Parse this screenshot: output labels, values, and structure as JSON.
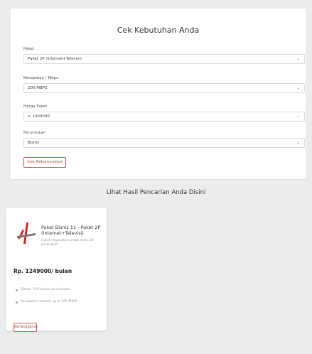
{
  "form": {
    "title": "Cek Kebutuhan Anda",
    "fields": [
      {
        "label": "Paket",
        "value": "Paket 2P (Internet+Televisi)"
      },
      {
        "label": "Kecepatan / Mbps",
        "value": "200 MBPS"
      },
      {
        "label": "Harga Paket",
        "value": "> 1000000"
      },
      {
        "label": "Peruntukan",
        "value": "Bisnis"
      }
    ],
    "submit_label": "Cek Rekomendasi"
  },
  "results": {
    "title": "Lihat Hasil Pencarian Anda Disini",
    "packages": [
      {
        "name": "Paket Bisnis 11 - Paket 2P (Internet+Televisi)",
        "description": "Cocok digunakan untuk maks 20 perangkat",
        "price": "Rp. 1249000/ bulan",
        "benefits": [
          "Diskon 70% biaya pasang baru",
          "Kecepatan internet up to 200 MBPS"
        ],
        "subscribe_label": "Berlangganan",
        "logo_colors": {
          "primary": "#d9261c",
          "secondary": "#7a7a7a"
        }
      }
    ]
  },
  "icons": {
    "select_caret": "chevron-down-icon",
    "logo": "telkom-logo-icon"
  }
}
